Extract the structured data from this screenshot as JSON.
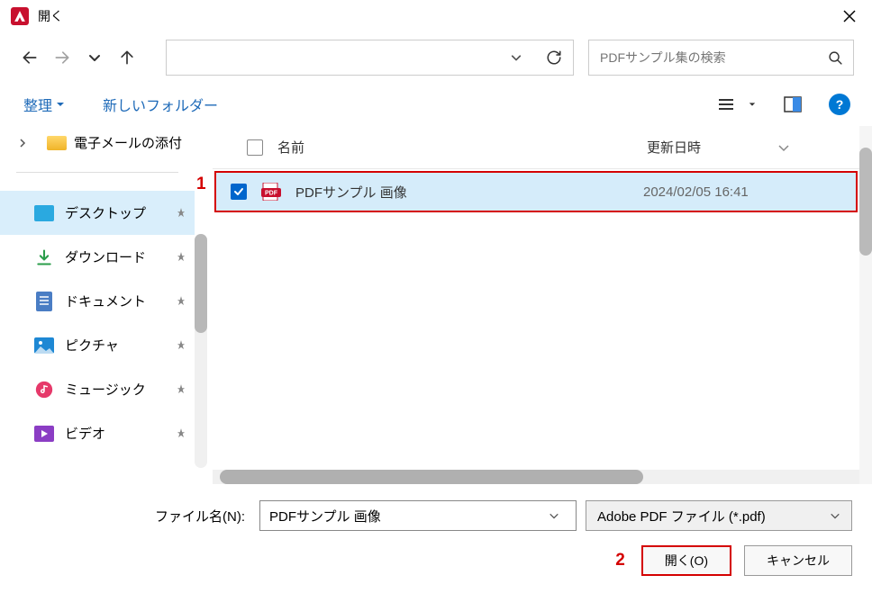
{
  "window": {
    "title": "開く"
  },
  "search": {
    "placeholder": "PDFサンプル集の検索"
  },
  "toolbar": {
    "organize": "整理",
    "new_folder": "新しいフォルダー"
  },
  "breadcrumb": {
    "folder": "電子メールの添付"
  },
  "sidebar": {
    "items": [
      {
        "label": "デスクトップ"
      },
      {
        "label": "ダウンロード"
      },
      {
        "label": "ドキュメント"
      },
      {
        "label": "ピクチャ"
      },
      {
        "label": "ミュージック"
      },
      {
        "label": "ビデオ"
      }
    ]
  },
  "file_header": {
    "name": "名前",
    "date": "更新日時"
  },
  "files": [
    {
      "name": "PDFサンプル 画像",
      "date": "2024/02/05 16:41"
    }
  ],
  "filename_row": {
    "label": "ファイル名(N):",
    "value": "PDFサンプル 画像",
    "type_filter": "Adobe PDF ファイル (*.pdf)"
  },
  "buttons": {
    "open": "開く(O)",
    "cancel": "キャンセル"
  },
  "annotations": {
    "marker1": "1",
    "marker2": "2"
  }
}
